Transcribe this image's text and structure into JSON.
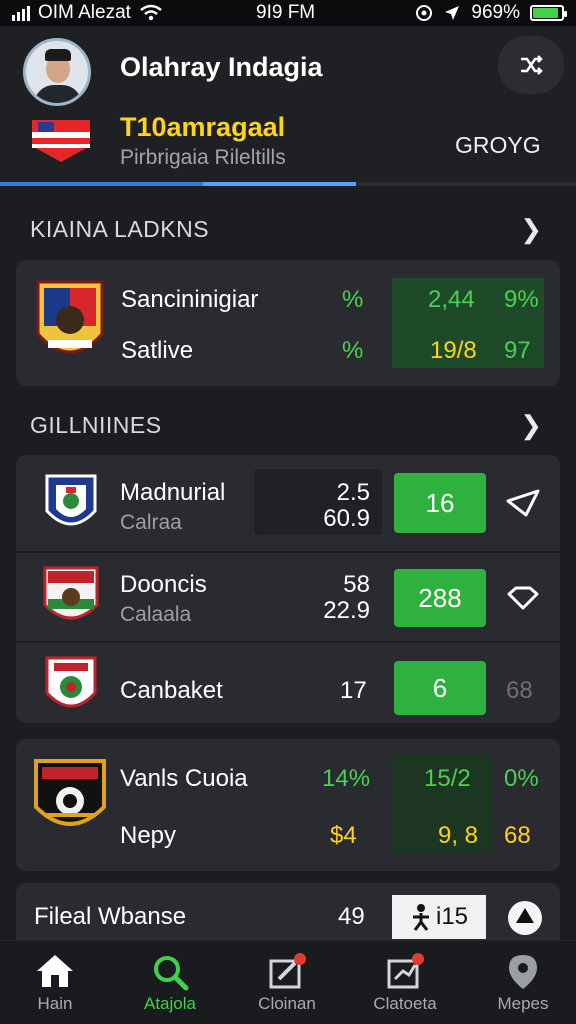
{
  "status_bar": {
    "carrier": "OIM Alezat",
    "time": "9I9 FM",
    "battery": "969%",
    "battery_level": 0.9
  },
  "header": {
    "user_name": "Olahray Indagia",
    "league_title": "T10amragaal",
    "league_subtitle": "Pirbrigaia Rileltills",
    "group_label": "GROYG"
  },
  "sections": [
    {
      "title": "KIAINA LADKNS",
      "rows": [
        {
          "team": "Sancininigiar",
          "col1": "%",
          "col2": "2,44",
          "col3": "9%"
        },
        {
          "team": "Satlive",
          "col1": "%",
          "col2": "19/8",
          "col3": "97"
        }
      ]
    },
    {
      "title": "GILLNIINES",
      "matches": [
        {
          "team": "Madnurial",
          "sub": "Calraa",
          "score_top": "2.5",
          "score_bottom": "60.9",
          "button": "16"
        },
        {
          "team": "Dooncis",
          "sub": "Calaala",
          "score_top": "58",
          "score_bottom": "22.9",
          "button": "288"
        },
        {
          "team": "Canbaket",
          "score": "17",
          "button": "6",
          "extra": "68"
        }
      ]
    }
  ],
  "stats_card": {
    "rows": [
      {
        "team": "Vanls Cuoia",
        "col1": "14%",
        "col2": "15/2",
        "col3": "0%"
      },
      {
        "team": "Nepy",
        "col1": "$4",
        "col2": "9, 8",
        "col3": "68"
      }
    ]
  },
  "last_row": {
    "team": "Fileal Wbanse",
    "value": "49",
    "box_text": "i15"
  },
  "nav": {
    "items": [
      {
        "label": "Hain",
        "icon": "home-icon"
      },
      {
        "label": "Atajola",
        "icon": "search-icon"
      },
      {
        "label": "Cloinan",
        "icon": "edit-icon"
      },
      {
        "label": "Clatoeta",
        "icon": "chart-icon"
      },
      {
        "label": "Mepes",
        "icon": "map-pin-icon"
      }
    ]
  },
  "colors": {
    "accent_green": "#2fb13f",
    "accent_yellow": "#ffd21f",
    "accent_blue": "#2f7fd9",
    "background": "#1c1d21",
    "card": "#2a2b30"
  }
}
